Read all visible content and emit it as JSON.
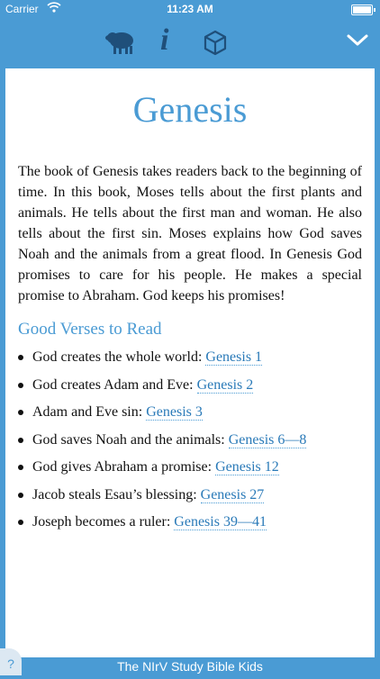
{
  "status_bar": {
    "carrier": "Carrier",
    "time": "11:23 AM",
    "icons": [
      "wifi-icon",
      "battery-icon"
    ]
  },
  "toolbar": {
    "icons": [
      "sheep-icon",
      "info-icon",
      "cube-icon",
      "chevron-down-icon"
    ],
    "info_glyph": "i"
  },
  "article": {
    "title": "Genesis",
    "intro": "The book of Genesis takes readers back to the beginning of time. In this book, Moses tells about the first plants and animals. He tells about the first man and woman. He also tells about the first sin. Moses explains how God saves Noah and the animals from a great flood. In Genesis God promises to care for his people. He makes a special promise to Abraham. God keeps his promises!",
    "section_title": "Good Verses to Read",
    "verses": [
      {
        "text": "God creates the whole world: ",
        "ref": "Genesis 1"
      },
      {
        "text": "God creates Adam and Eve: ",
        "ref": "Genesis 2"
      },
      {
        "text": "Adam and Eve sin: ",
        "ref": "Genesis 3"
      },
      {
        "text": "God saves Noah and the animals: ",
        "ref": "Genesis 6—8"
      },
      {
        "text": "God gives Abraham a promise: ",
        "ref": "Genesis 12"
      },
      {
        "text": "Jacob steals Esau’s blessing: ",
        "ref": "Genesis 27"
      },
      {
        "text": "Joseph becomes a ruler: ",
        "ref": "Genesis 39—41"
      }
    ]
  },
  "footer": {
    "label": "The NIrV Study Bible Kids",
    "help_glyph": "?"
  },
  "colors": {
    "accent": "#4a9bd4",
    "dark_icon": "#1f4f7a",
    "link": "#2a7ab8"
  }
}
